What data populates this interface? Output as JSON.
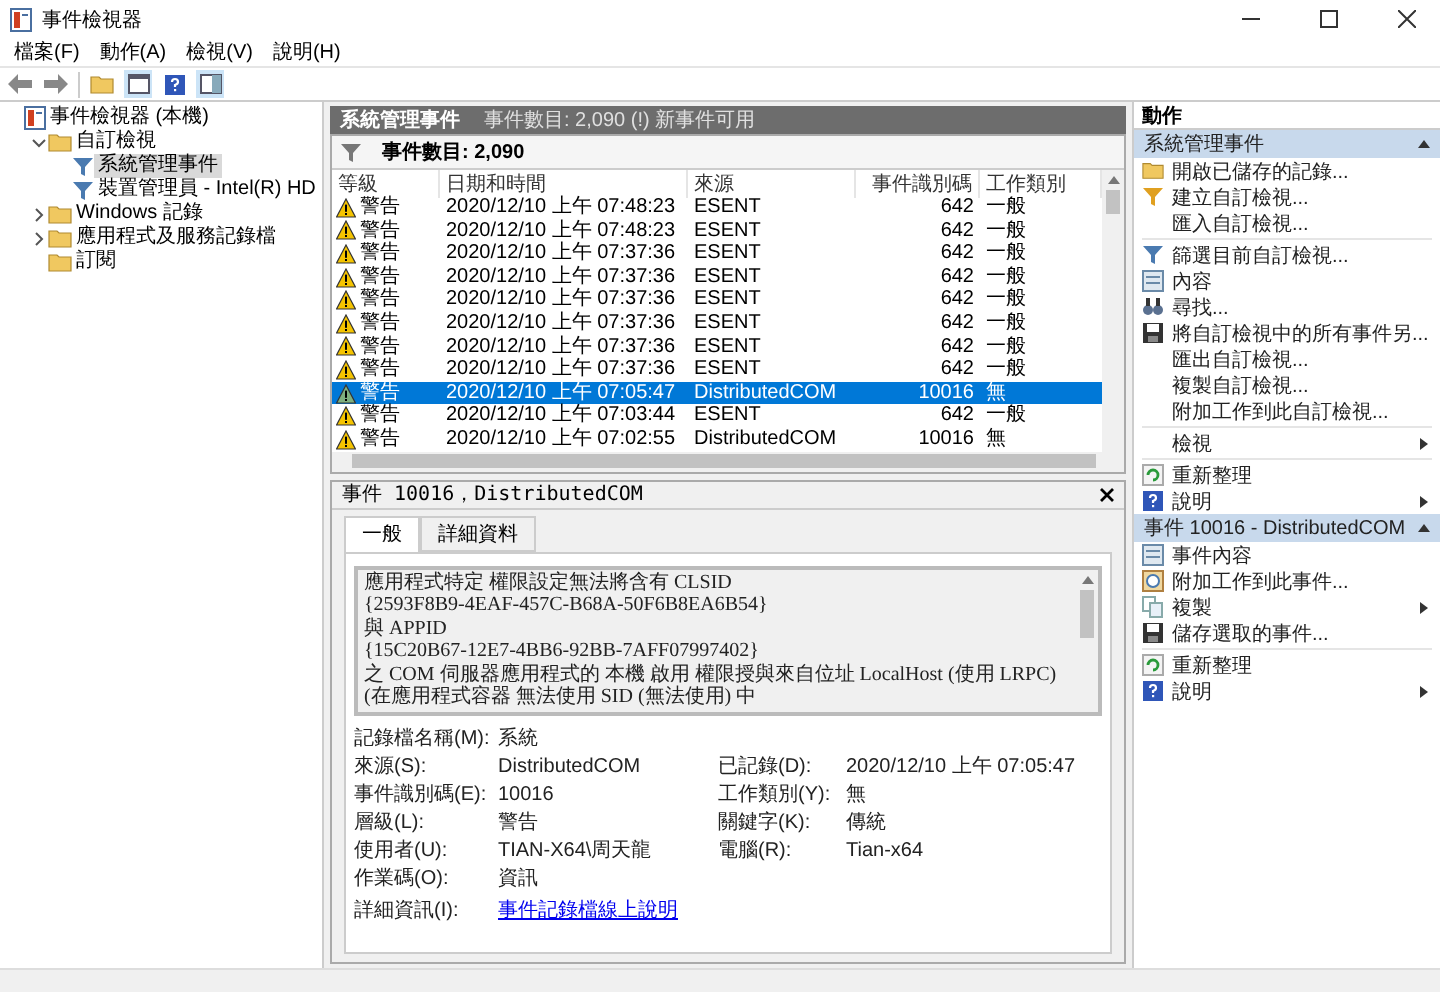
{
  "window": {
    "title": "事件檢視器"
  },
  "menu": [
    {
      "label": "檔案(F)"
    },
    {
      "label": "動作(A)"
    },
    {
      "label": "檢視(V)"
    },
    {
      "label": "說明(H)"
    }
  ],
  "tree": {
    "items": [
      {
        "label": "事件檢視器 (本機)",
        "selected": false,
        "children": [
          {
            "label": "自訂檢視",
            "selected": false,
            "expanded": true,
            "children": [
              {
                "label": "系統管理事件",
                "selected": true
              },
              {
                "label": "裝置管理員 - Intel(R) HD",
                "selected": false
              }
            ]
          },
          {
            "label": "Windows 記錄",
            "selected": false,
            "expanded": false
          },
          {
            "label": "應用程式及服務記錄檔",
            "selected": false,
            "expanded": false
          },
          {
            "label": "訂閱",
            "selected": false
          }
        ]
      }
    ]
  },
  "events_panel": {
    "title": "系統管理事件",
    "subtitle": "事件數目: 2,090 (!) 新事件可用",
    "filter_label": "事件數目: 2,090",
    "columns": [
      "等級",
      "日期和時間",
      "來源",
      "事件識別碼",
      "工作類別"
    ],
    "rows": [
      {
        "level": "警告",
        "datetime": "2020/12/10 上午 07:48:23",
        "source": "ESENT",
        "event_id": "642",
        "category": "一般",
        "selected": false
      },
      {
        "level": "警告",
        "datetime": "2020/12/10 上午 07:48:23",
        "source": "ESENT",
        "event_id": "642",
        "category": "一般",
        "selected": false
      },
      {
        "level": "警告",
        "datetime": "2020/12/10 上午 07:37:36",
        "source": "ESENT",
        "event_id": "642",
        "category": "一般",
        "selected": false
      },
      {
        "level": "警告",
        "datetime": "2020/12/10 上午 07:37:36",
        "source": "ESENT",
        "event_id": "642",
        "category": "一般",
        "selected": false
      },
      {
        "level": "警告",
        "datetime": "2020/12/10 上午 07:37:36",
        "source": "ESENT",
        "event_id": "642",
        "category": "一般",
        "selected": false
      },
      {
        "level": "警告",
        "datetime": "2020/12/10 上午 07:37:36",
        "source": "ESENT",
        "event_id": "642",
        "category": "一般",
        "selected": false
      },
      {
        "level": "警告",
        "datetime": "2020/12/10 上午 07:37:36",
        "source": "ESENT",
        "event_id": "642",
        "category": "一般",
        "selected": false
      },
      {
        "level": "警告",
        "datetime": "2020/12/10 上午 07:37:36",
        "source": "ESENT",
        "event_id": "642",
        "category": "一般",
        "selected": false
      },
      {
        "level": "警告",
        "datetime": "2020/12/10 上午 07:05:47",
        "source": "DistributedCOM",
        "event_id": "10016",
        "category": "無",
        "selected": true
      },
      {
        "level": "警告",
        "datetime": "2020/12/10 上午 07:03:44",
        "source": "ESENT",
        "event_id": "642",
        "category": "一般",
        "selected": false
      },
      {
        "level": "警告",
        "datetime": "2020/12/10 上午 07:02:55",
        "source": "DistributedCOM",
        "event_id": "10016",
        "category": "無",
        "selected": false
      }
    ]
  },
  "detail": {
    "title": "事件 10016，DistributedCOM",
    "tabs": [
      {
        "label": "一般",
        "selected": true
      },
      {
        "label": "詳細資料",
        "selected": false
      }
    ],
    "description": [
      "應用程式特定 權限設定無法將含有 CLSID",
      "{2593F8B9-4EAF-457C-B68A-50F6B8EA6B54}",
      "與 APPID",
      "{15C20B67-12E7-4BB6-92BB-7AFF07997402}",
      "之 COM 伺服器應用程式的 本機 啟用 權限授與來自位址 LocalHost (使用 LRPC) (在應用程式容器 無法使用 SID (無法使用) 中"
    ],
    "fields": [
      {
        "left": {
          "label": "記錄檔名稱(M):",
          "value": "系統"
        }
      },
      {
        "left": {
          "label": "來源(S):",
          "value": "DistributedCOM"
        },
        "right": {
          "label": "已記錄(D):",
          "value": "2020/12/10 上午 07:05:47"
        }
      },
      {
        "left": {
          "label": "事件識別碼(E):",
          "value": "10016"
        },
        "right": {
          "label": "工作類別(Y):",
          "value": "無"
        }
      },
      {
        "left": {
          "label": "層級(L):",
          "value": "警告"
        },
        "right": {
          "label": "關鍵字(K):",
          "value": "傳統"
        }
      },
      {
        "left": {
          "label": "使用者(U):",
          "value": "TIAN-X64\\周天龍"
        },
        "right": {
          "label": "電腦(R):",
          "value": "Tian-x64"
        }
      },
      {
        "left": {
          "label": "作業碼(O):",
          "value": "資訊"
        }
      }
    ],
    "link": {
      "label": "詳細資訊(I):",
      "text": "事件記錄檔線上說明"
    }
  },
  "actions": {
    "title": "動作",
    "sections": [
      {
        "title": "系統管理事件",
        "expanded": true,
        "groups": [
          [
            {
              "label": "開啟已儲存的記錄...",
              "submenu": false
            },
            {
              "label": "建立自訂檢視...",
              "submenu": false
            },
            {
              "label": "匯入自訂檢視...",
              "submenu": false
            }
          ],
          [
            {
              "label": "篩選目前自訂檢視...",
              "submenu": false
            },
            {
              "label": "內容",
              "submenu": false
            },
            {
              "label": "尋找...",
              "submenu": false
            },
            {
              "label": "將自訂檢視中的所有事件另...",
              "submenu": false
            },
            {
              "label": "匯出自訂檢視...",
              "submenu": false
            },
            {
              "label": "複製自訂檢視...",
              "submenu": false
            },
            {
              "label": "附加工作到此自訂檢視...",
              "submenu": false
            }
          ],
          [
            {
              "label": "檢視",
              "submenu": true
            }
          ],
          [
            {
              "label": "重新整理",
              "submenu": false
            },
            {
              "label": "說明",
              "submenu": true
            }
          ]
        ]
      },
      {
        "title": "事件 10016 - DistributedCOM",
        "expanded": true,
        "groups": [
          [
            {
              "label": "事件內容",
              "submenu": false
            },
            {
              "label": "附加工作到此事件...",
              "submenu": false
            },
            {
              "label": "複製",
              "submenu": true
            },
            {
              "label": "儲存選取的事件...",
              "submenu": false
            }
          ],
          [
            {
              "label": "重新整理",
              "submenu": false
            },
            {
              "label": "說明",
              "submenu": true
            }
          ]
        ]
      }
    ]
  }
}
